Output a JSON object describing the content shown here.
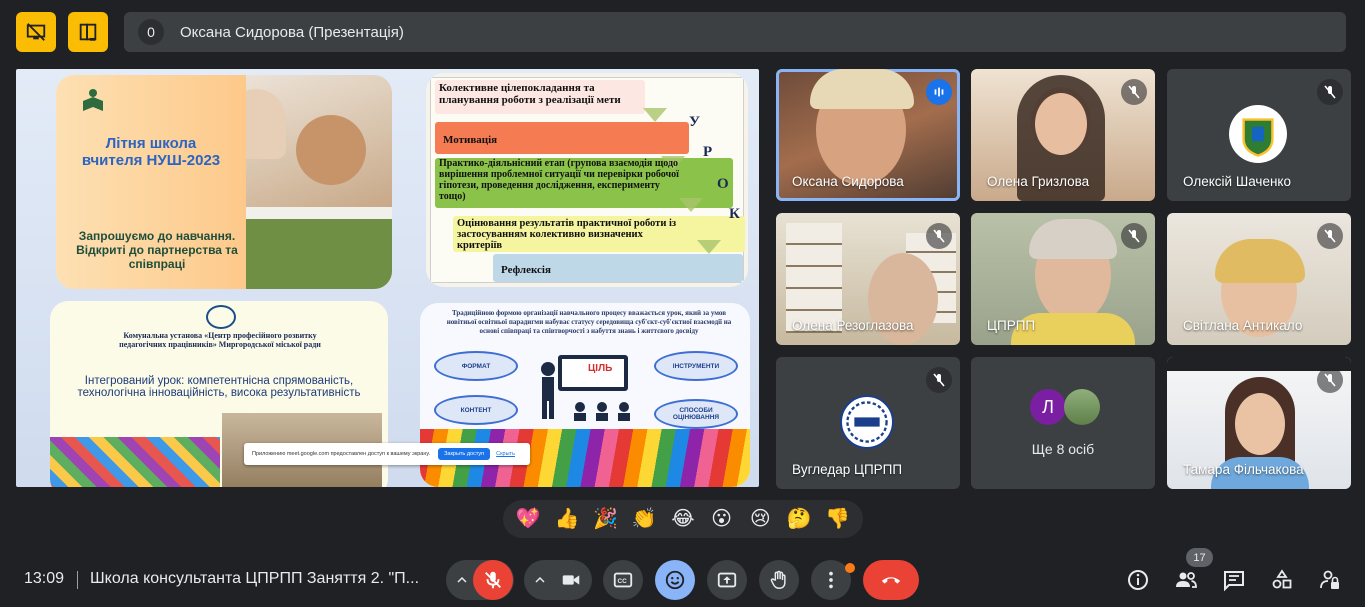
{
  "top_bar": {
    "presenter_count": "0",
    "presenter_name": "Оксана Сидорова (Презентація)"
  },
  "presentation": {
    "slide1": {
      "title": "Літня школа вчителя НУШ-2023",
      "subtitle": "Запрошуємо до навчання. Відкриті до партнерства та співпраці"
    },
    "slide2": {
      "row1": "Колективне цілепокладання та планування роботи з реалізації мети",
      "row2": "Мотивація",
      "row3": "Практико-діяльнісний етап (групова взаємодія щодо вирішення проблемної ситуації чи перевірки робочої гіпотези, проведення дослідження, експерименту тощо)",
      "row4": "Оцінювання результатів практичної роботи із застосуванням колективно визначених критеріїв",
      "row5": "Рефлексія",
      "letters": [
        "У",
        "Р",
        "О",
        "К"
      ]
    },
    "slide3": {
      "org": "Комунальна установа «Центр професійного розвитку педагогічних працівників» Миргородської міської ради",
      "topic": "Інтегрований урок: компетентнісна спрямованість, технологічна інноваційність, висока результативність"
    },
    "slide4": {
      "text": "Традиційною формою організації навчального процесу вважається урок, який за умов новітньої освітньої парадигми набуває статусу середовища суб'єкт-суб'єктної взаємодії на основі співпраці та співтворчості з набуття знань і життєвого досвіду",
      "board": "ЦІЛЬ",
      "ellipses": [
        "ФОРМАТ",
        "ІНСТРУМЕНТИ",
        "КОНТЕНТ",
        "СПОСОБИ ОЦІНЮВАННЯ"
      ]
    },
    "toast": {
      "text": "Приложению meet.google.com предоставлен доступ к вашему экрану.",
      "button": "Закрыть доступ",
      "link": "Скрыть"
    }
  },
  "participants": [
    {
      "name": "Оксана Сидорова",
      "state": "speaking"
    },
    {
      "name": "Олена Гризлова",
      "state": "muted"
    },
    {
      "name": "Олексій Шаченко",
      "state": "muted"
    },
    {
      "name": "Олена Резоглазова",
      "state": "muted"
    },
    {
      "name": "ЦПРПП",
      "state": "muted"
    },
    {
      "name": "Світлана Антикало",
      "state": "muted"
    },
    {
      "name": "Вугледар ЦПРПП",
      "state": "muted"
    },
    {
      "name": "Ще 8 осіб",
      "avatar_letter": "Л"
    },
    {
      "name": "Тамара Фільчакова",
      "state": "muted"
    }
  ],
  "reactions": [
    "💖",
    "👍",
    "🎉",
    "👏",
    "😂",
    "😮",
    "😢",
    "🤔",
    "👎"
  ],
  "bottom_bar": {
    "time": "13:09",
    "meeting_title": "Школа консультанта ЦПРПП Заняття 2. \"П...",
    "people_count": "17"
  },
  "colors": {
    "background": "#202124",
    "tile": "#3c4043",
    "accent_yellow": "#fbbc04",
    "danger": "#ea4335",
    "active_blue": "#8ab4f8"
  }
}
